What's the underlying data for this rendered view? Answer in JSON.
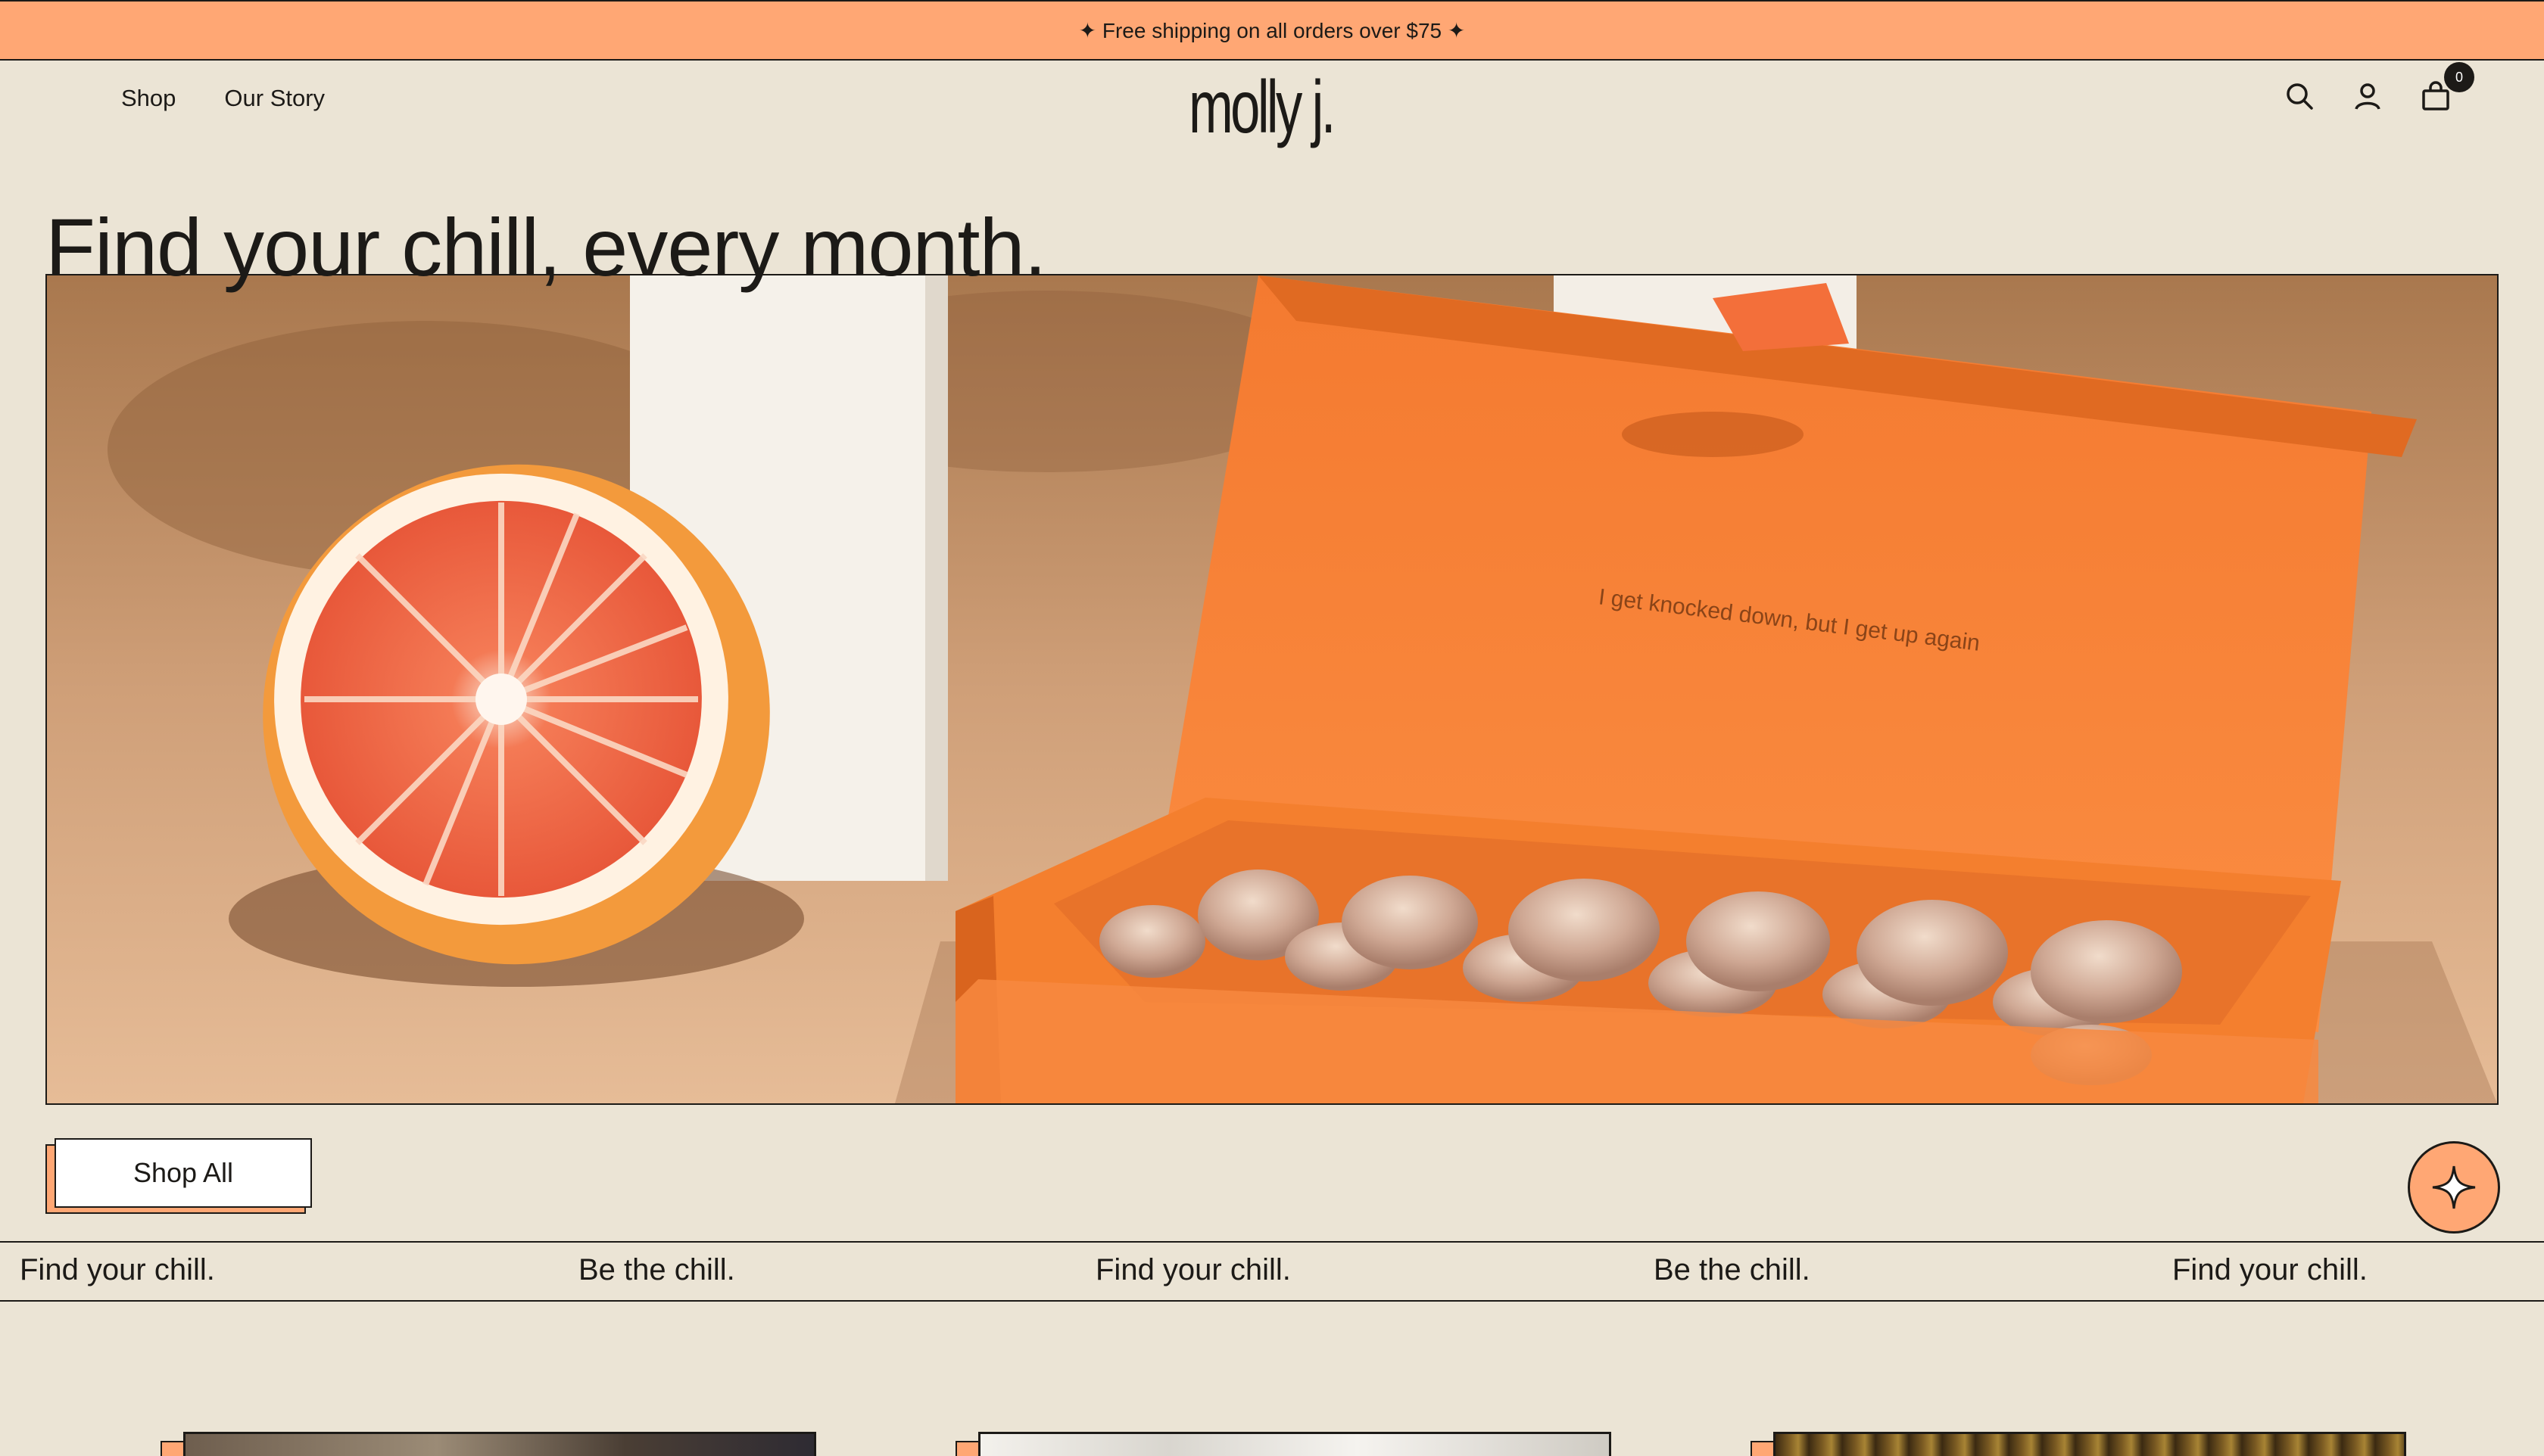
{
  "announcement": {
    "text": "✦ Free shipping on all orders over $75 ✦"
  },
  "header": {
    "nav": [
      {
        "label": "Shop"
      },
      {
        "label": "Our Story"
      }
    ],
    "logo": "molly j.",
    "cart_count": "0"
  },
  "hero": {
    "title": "Find your chill, every month.",
    "box_inscription": "I get knocked down, but I get up again",
    "cta_label": "Shop All"
  },
  "marquee": {
    "items": [
      "Find your chill.",
      "Be the chill.",
      "Find your chill.",
      "Be the chill.",
      "Find your chill."
    ]
  },
  "colors": {
    "background": "#ebe4d5",
    "accent": "#ffa774",
    "ink": "#1c1a17",
    "box_orange": "#f7883f"
  },
  "icons": [
    "search-icon",
    "account-icon",
    "cart-icon",
    "sparkle-icon"
  ]
}
